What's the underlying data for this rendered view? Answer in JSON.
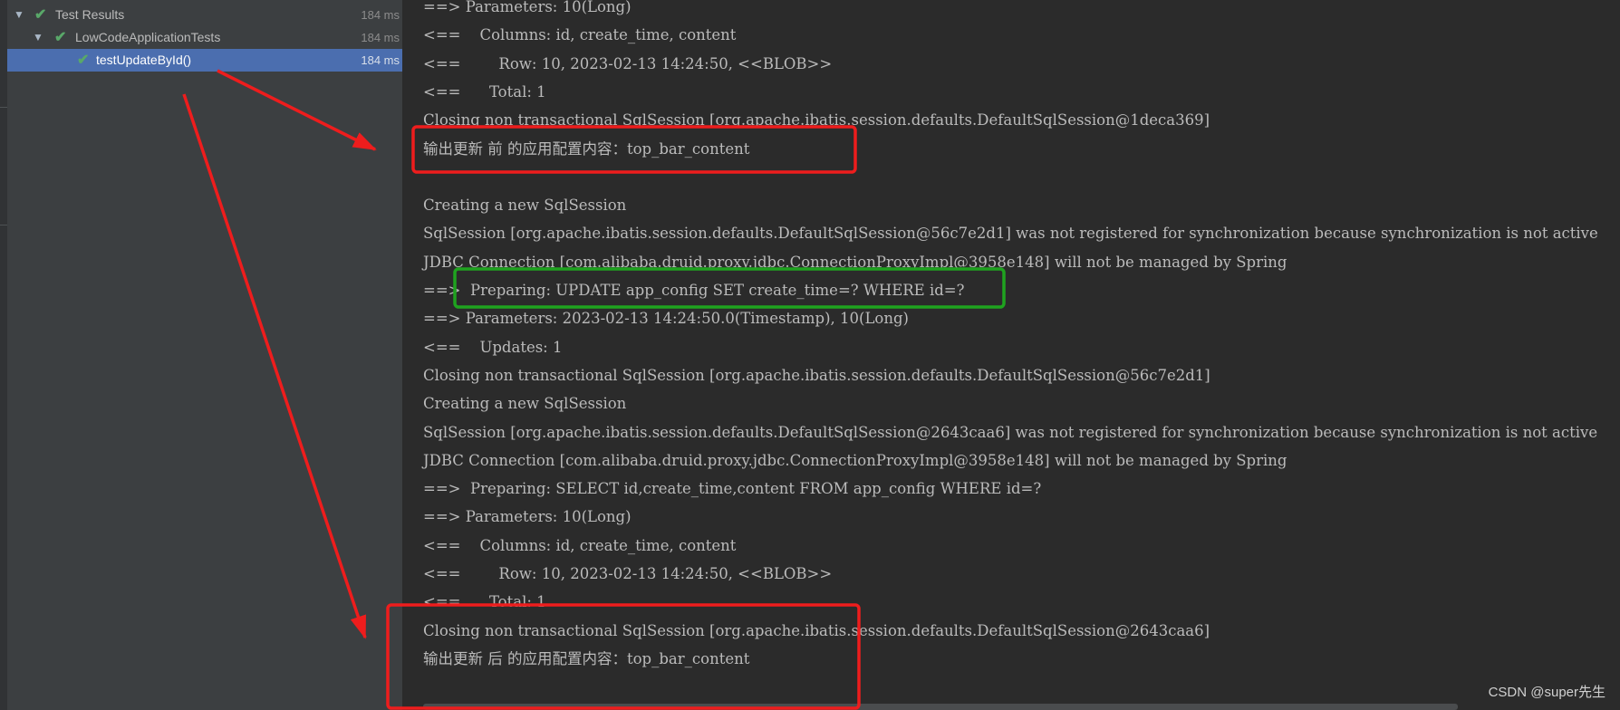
{
  "test_tree": {
    "items": [
      {
        "label": "Test Results",
        "time": "184 ms",
        "status": "passed",
        "expanded": true
      },
      {
        "label": "LowCodeApplicationTests",
        "time": "184 ms",
        "status": "passed",
        "expanded": true
      },
      {
        "label": "testUpdateById()",
        "time": "184 ms",
        "status": "passed",
        "selected": true
      }
    ],
    "expand_glyph": "▼",
    "check_glyph": "✔",
    "pass_color": "#59a869",
    "selection_color": "#4b6eaf"
  },
  "console": {
    "lines": [
      "==> Parameters: 10(Long)",
      "<==    Columns: id, create_time, content",
      "<==        Row: 10, 2023-02-13 14:24:50, <<BLOB>>",
      "<==      Total: 1",
      "Closing non transactional SqlSession [org.apache.ibatis.session.defaults.DefaultSqlSession@1deca369]",
      "输出更新 前 的应用配置内容：top_bar_content",
      "",
      "Creating a new SqlSession",
      "SqlSession [org.apache.ibatis.session.defaults.DefaultSqlSession@56c7e2d1] was not registered for synchronization because synchronization is not active",
      "JDBC Connection [com.alibaba.druid.proxy.jdbc.ConnectionProxyImpl@3958e148] will not be managed by Spring",
      "==>  Preparing: UPDATE app_config SET create_time=? WHERE id=?",
      "==> Parameters: 2023-02-13 14:24:50.0(Timestamp), 10(Long)",
      "<==    Updates: 1",
      "Closing non transactional SqlSession [org.apache.ibatis.session.defaults.DefaultSqlSession@56c7e2d1]",
      "Creating a new SqlSession",
      "SqlSession [org.apache.ibatis.session.defaults.DefaultSqlSession@2643caa6] was not registered for synchronization because synchronization is not active",
      "JDBC Connection [com.alibaba.druid.proxy.jdbc.ConnectionProxyImpl@3958e148] will not be managed by Spring",
      "==>  Preparing: SELECT id,create_time,content FROM app_config WHERE id=?",
      "==> Parameters: 10(Long)",
      "<==    Columns: id, create_time, content",
      "<==        Row: 10, 2023-02-13 14:24:50, <<BLOB>>",
      "<==      Total: 1",
      "Closing non transactional SqlSession [org.apache.ibatis.session.defaults.DefaultSqlSession@2643caa6]",
      "输出更新 后 的应用配置内容：top_bar_content"
    ]
  },
  "annotations": {
    "box_red": "#ee1d1d",
    "box_green": "#1fa31f",
    "arrow_color": "#ee1d1d"
  },
  "watermark": "CSDN @super先生"
}
